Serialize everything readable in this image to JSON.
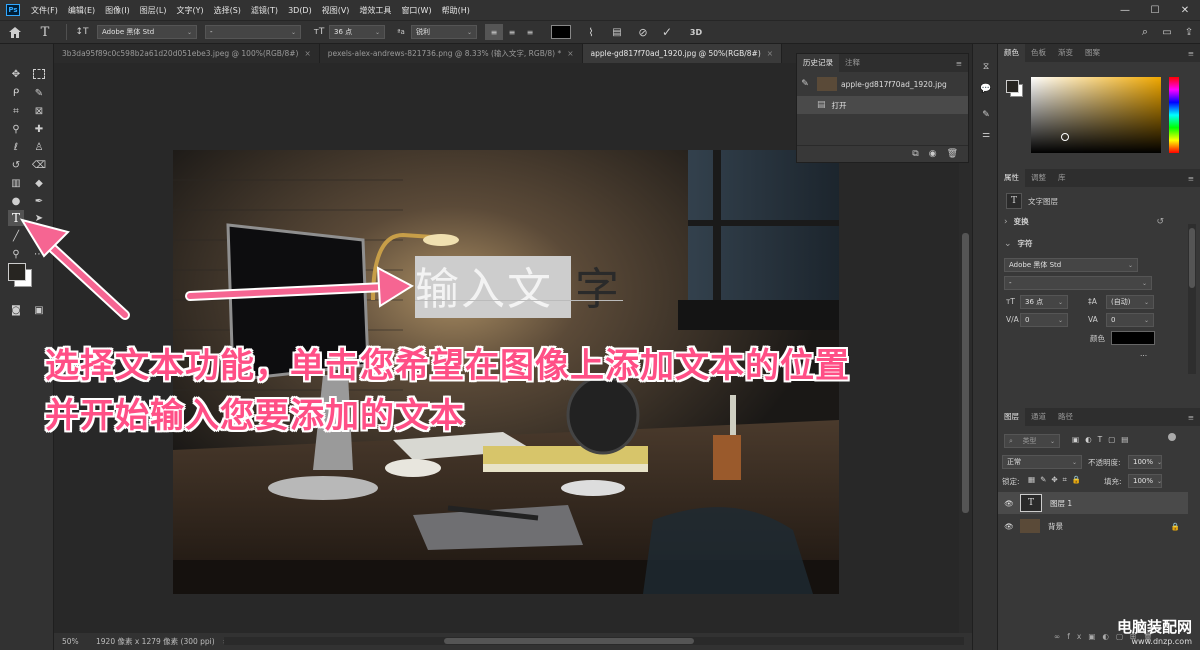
{
  "app": {
    "logo": "Ps"
  },
  "menubar": {
    "items": [
      "文件(F)",
      "编辑(E)",
      "图像(I)",
      "图层(L)",
      "文字(Y)",
      "选择(S)",
      "滤镜(T)",
      "3D(D)",
      "视图(V)",
      "增效工具",
      "窗口(W)",
      "帮助(H)"
    ],
    "controls": {
      "minimize": "—",
      "maximize": "☐",
      "close": "✕"
    }
  },
  "options": {
    "font_family": "Adobe 黑体 Std",
    "font_style": "-",
    "font_size": "36 点",
    "antialias": "锐利",
    "text_color": "#000000",
    "label_3d": "3D"
  },
  "tabs": [
    {
      "label": "3b3da95f89c0c598b2a61d20d051ebe3.jpeg @ 100%(RGB/8#)",
      "close": "×"
    },
    {
      "label": "pexels-alex-andrews-821736.png @ 8.33% (输入文字, RGB/8) *",
      "close": "×"
    },
    {
      "label": "apple-gd817f70ad_1920.jpg @ 50%(RGB/8#)",
      "close": "×"
    }
  ],
  "canvas": {
    "selected_text": "输入文",
    "unselected_text": "字"
  },
  "annotation": {
    "line1": "选择文本功能，单击您希望在图像上添加文本的位置",
    "line2": "并开始输入您要添加的文本"
  },
  "history": {
    "tabs": [
      "历史记录",
      "注释"
    ],
    "items": [
      {
        "label": "apple-gd817f70ad_1920.jpg"
      },
      {
        "label": "打开"
      }
    ]
  },
  "color_panel": {
    "tabs": [
      "颜色",
      "色板",
      "渐变",
      "图案"
    ],
    "accent": "#f0a800"
  },
  "properties": {
    "tabs": [
      "属性",
      "调整",
      "库"
    ],
    "type_label": "文字图层",
    "transform": "变换",
    "character": "字符",
    "font_family": "Adobe 黑体 Std",
    "font_style": "-",
    "size": "36 点",
    "leading": "(自动)",
    "kerning": "0",
    "tracking": "0",
    "color_label": "颜色",
    "more": "..."
  },
  "layers": {
    "tabs": [
      "图层",
      "通道",
      "路径"
    ],
    "search_placeholder": "类型",
    "blend_mode": "正常",
    "opacity_label": "不透明度:",
    "opacity": "100%",
    "lock_label": "锁定:",
    "fill_label": "填充:",
    "fill": "100%",
    "items": [
      {
        "name": "图层 1",
        "type": "text"
      },
      {
        "name": "背景",
        "type": "image"
      }
    ]
  },
  "status": {
    "zoom": "50%",
    "doc_info": "1920 像素 x 1279 像素 (300 ppi)"
  },
  "watermark": {
    "line1": "电脑装配网",
    "line2": "www.dnzp.com"
  }
}
